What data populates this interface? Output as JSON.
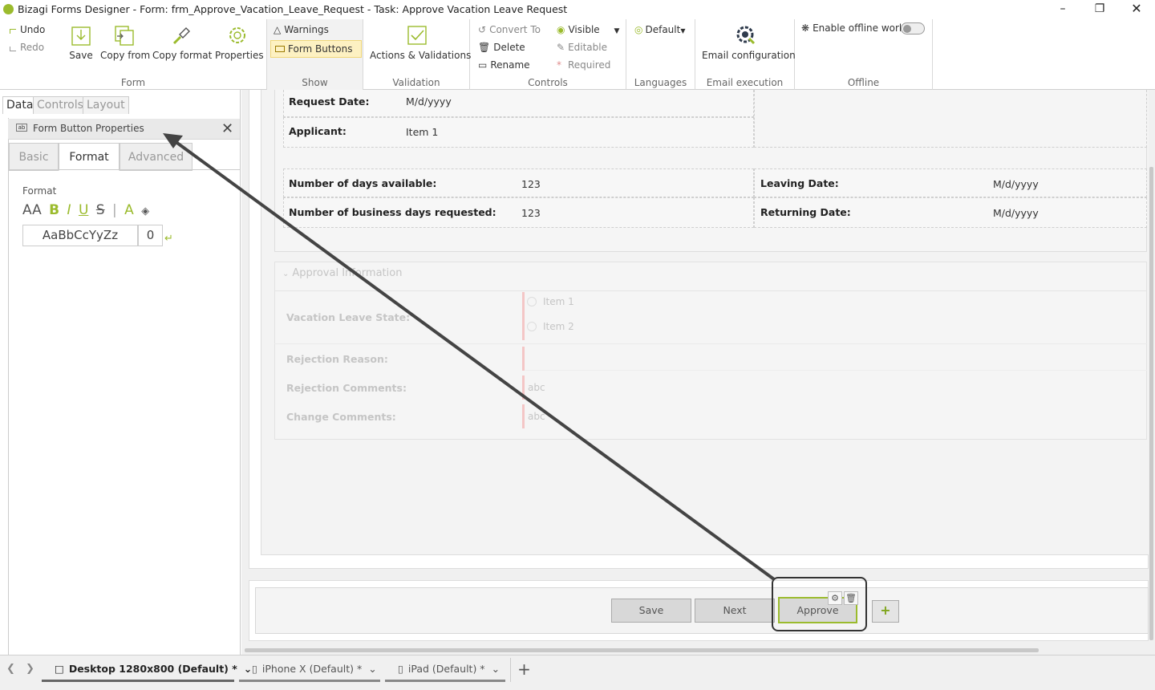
{
  "window": {
    "title": "Bizagi Forms Designer  - Form: frm_Approve_Vacation_Leave_Request - Task:  Approve Vacation Leave Request"
  },
  "ribbon": {
    "undo": "Undo",
    "redo": "Redo",
    "save": "Save",
    "copy_from": "Copy from",
    "copy_format": "Copy format",
    "properties": "Properties",
    "group_form": "Form",
    "warnings": "Warnings",
    "form_buttons": "Form Buttons",
    "group_show": "Show",
    "actions_validations": "Actions & Validations",
    "group_validation": "Validation",
    "convert_to": "Convert To",
    "delete": "Delete",
    "rename": "Rename",
    "visible": "Visible",
    "editable": "Editable",
    "required": "Required",
    "group_controls": "Controls",
    "language_default": "Default",
    "group_languages": "Languages",
    "email_configuration": "Email configuration",
    "group_email": "Email execution",
    "enable_offline": "Enable offline work",
    "group_offline": "Offline",
    "accent_color": "#9bbb2d"
  },
  "left_panel": {
    "tabs": [
      "Data",
      "Controls",
      "Layout"
    ],
    "props_title": "Form Button Properties",
    "sub_tabs": [
      "Basic",
      "Format",
      "Advanced"
    ],
    "format_label": "Format",
    "format_icons": [
      "AA",
      "B",
      "I",
      "U",
      "S",
      "A"
    ],
    "font_sample": "AaBbCcYyZz",
    "font_size": "0"
  },
  "form": {
    "request_date_label": "Request Date:",
    "request_date_value": "M/d/yyyy",
    "applicant_label": "Applicant:",
    "applicant_value": "Item 1",
    "days_available_label": "Number of days available:",
    "days_available_value": "123",
    "leaving_date_label": "Leaving Date:",
    "leaving_date_value": "M/d/yyyy",
    "business_days_label": "Number of business days requested:",
    "business_days_value": "123",
    "returning_date_label": "Returning Date:",
    "returning_date_value": "M/d/yyyy",
    "approval_group_title": "Approval Information",
    "leave_state_label": "Vacation Leave State:",
    "radio_item1": "Item 1",
    "radio_item2": "Item 2",
    "rejection_reason_label": "Rejection Reason:",
    "rejection_comments_label": "Rejection Comments:",
    "rejection_comments_value": "abc",
    "change_comments_label": "Change Comments:",
    "change_comments_value": "abc"
  },
  "form_buttons": {
    "save": "Save",
    "next": "Next",
    "approve": "Approve"
  },
  "bottom_tabs": {
    "desktop": "Desktop 1280x800 (Default) *",
    "iphone": "iPhone X (Default) *",
    "ipad": "iPad (Default) *"
  }
}
